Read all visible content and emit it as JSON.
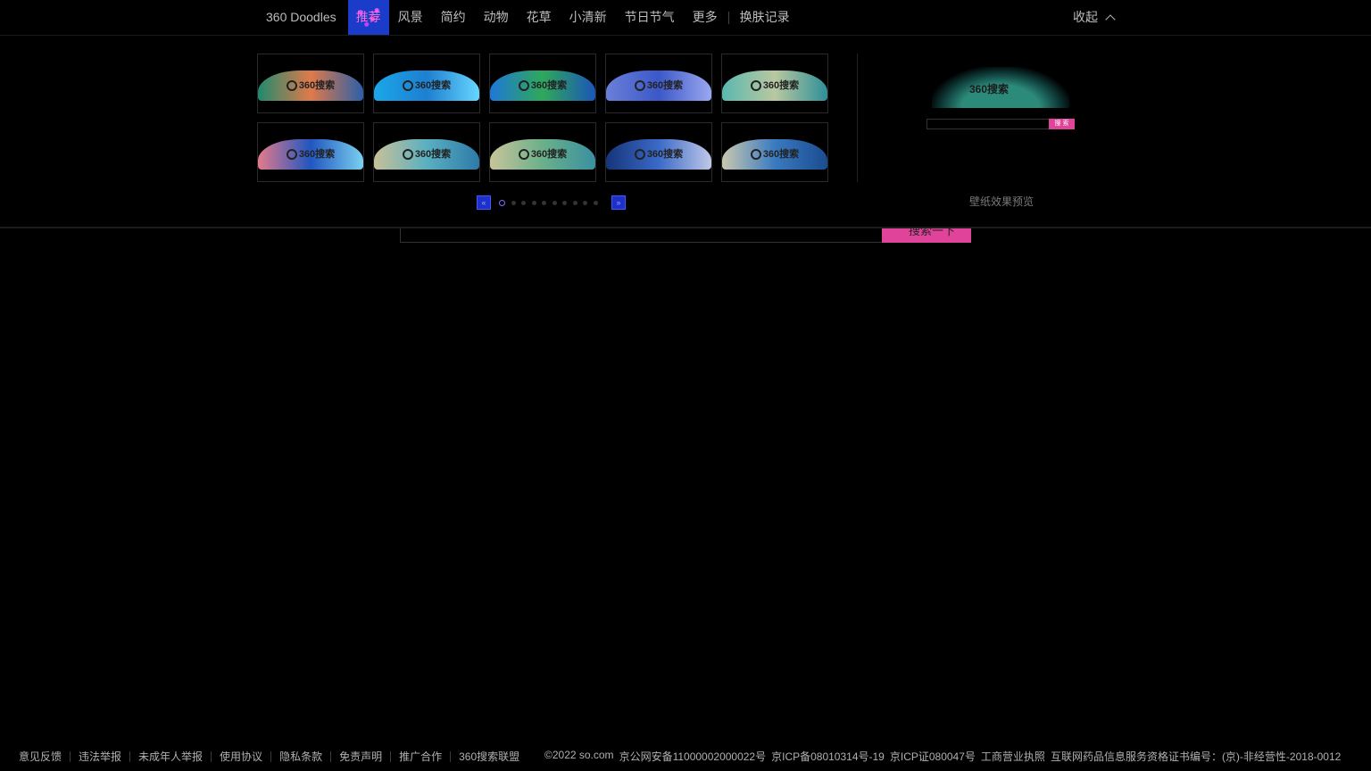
{
  "nav": {
    "brand": "360 Doodles",
    "active_label": "推荐",
    "items": [
      "风景",
      "简约",
      "动物",
      "花草",
      "小清新",
      "节日节气",
      "更多"
    ],
    "history": "换肤记录",
    "collapse": "收起"
  },
  "skins": {
    "logo_text": "360搜索",
    "thumbs": [
      {
        "colors": [
          "#1f8a6e",
          "#e07a4a",
          "#2b5fa8"
        ]
      },
      {
        "colors": [
          "#1ba7e8",
          "#1d7fd0",
          "#66d6ff"
        ]
      },
      {
        "colors": [
          "#1e78d8",
          "#2fa85a",
          "#1b56b8"
        ]
      },
      {
        "colors": [
          "#6a7fd8",
          "#3b58c8",
          "#9aa8ef"
        ]
      },
      {
        "colors": [
          "#5ab8b0",
          "#b9c8a0",
          "#2e8f98"
        ]
      },
      {
        "colors": [
          "#e47a8c",
          "#2156c0",
          "#7ad0f0"
        ]
      },
      {
        "colors": [
          "#c9c098",
          "#5ab0c0",
          "#2e7aa8"
        ]
      },
      {
        "colors": [
          "#c8c49a",
          "#6ab08a",
          "#3a90a0"
        ]
      },
      {
        "colors": [
          "#16347a",
          "#3a6ac8",
          "#c0c8e8"
        ]
      },
      {
        "colors": [
          "#c8c8b0",
          "#3a7ac0",
          "#1a4c90"
        ]
      }
    ],
    "pager": {
      "prev": "«",
      "next": "»",
      "pages": 10,
      "current": 1
    }
  },
  "preview": {
    "logo_text": "360搜索",
    "button_text": "搜 索",
    "caption": "壁纸效果预览"
  },
  "search": {
    "button_label": "搜索一下"
  },
  "footer": {
    "links": [
      "意见反馈",
      "违法举报",
      "未成年人举报",
      "使用协议",
      "隐私条款",
      "免责声明",
      "推广合作",
      "360搜索联盟"
    ],
    "legal": [
      "©2022 so.com",
      "京公网安备11000002000022号",
      "京ICP备08010314号-19",
      "京ICP证080047号",
      "工商营业执照",
      "互联网药品信息服务资格证书编号：(京)-非经营性-2018-0012"
    ]
  },
  "colors": {
    "accent": "#e0449a",
    "nav_active": "#1a3cc8",
    "background": "#000000"
  }
}
